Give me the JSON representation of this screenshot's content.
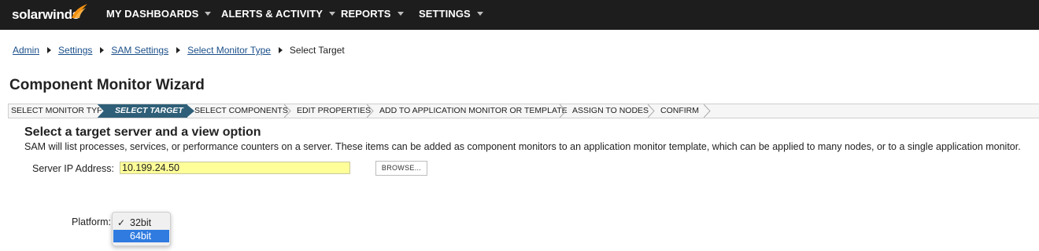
{
  "header": {
    "logo_text": "solarwinds",
    "nav": [
      {
        "label": "MY DASHBOARDS"
      },
      {
        "label": "ALERTS & ACTIVITY"
      },
      {
        "label": "REPORTS"
      },
      {
        "label": "SETTINGS"
      }
    ]
  },
  "breadcrumb": {
    "links": [
      "Admin",
      "Settings",
      "SAM Settings",
      "Select Monitor Type"
    ],
    "current": "Select Target"
  },
  "page": {
    "title": "Component Monitor Wizard"
  },
  "wizard": {
    "steps": [
      {
        "label": "SELECT MONITOR TYPE"
      },
      {
        "label": "SELECT TARGET",
        "active": true
      },
      {
        "label": "SELECT COMPONENTS"
      },
      {
        "label": "EDIT PROPERTIES"
      },
      {
        "label": "ADD TO APPLICATION MONITOR OR TEMPLATE"
      },
      {
        "label": "ASSIGN TO NODES"
      },
      {
        "label": "CONFIRM"
      }
    ]
  },
  "content": {
    "section_title": "Select a target server and a view option",
    "description": "SAM will list processes, services, or performance counters on a server. These items can be added as component monitors to an application monitor template, which can be applied to many nodes, or to a single application monitor.",
    "ip_label": "Server IP Address:",
    "ip_value": "10.199.24.50",
    "browse_label": "BROWSE...",
    "platform_label": "Platform:",
    "platform_options": [
      {
        "label": "32bit",
        "checked": true
      },
      {
        "label": "64bit",
        "highlighted": true
      }
    ]
  },
  "colors": {
    "topbar": "#1d1d1d",
    "accent_orange": "#f29111",
    "link": "#1b4f8a",
    "active_step": "#2f5f78",
    "input_highlight": "#ffff99",
    "dropdown_selection": "#2f7be0"
  },
  "icons": {
    "logo": "solarwinds-flame-icon",
    "nav_caret": "chevron-down-icon",
    "breadcrumb_separator": "triangle-right-icon",
    "step_separator": "chevron-right-icon",
    "checkmark": "check-icon"
  }
}
